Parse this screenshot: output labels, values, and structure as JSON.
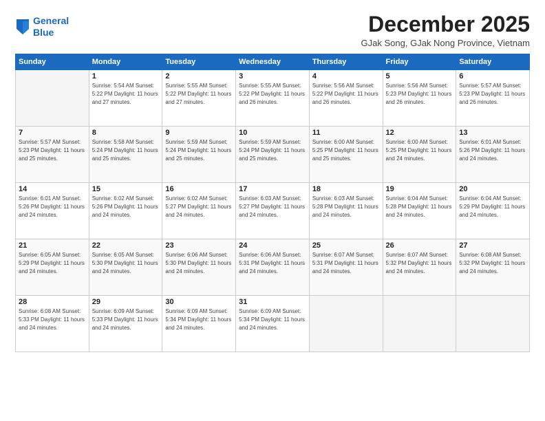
{
  "logo": {
    "line1": "General",
    "line2": "Blue"
  },
  "title": "December 2025",
  "location": "GJak Song, GJak Nong Province, Vietnam",
  "days_header": [
    "Sunday",
    "Monday",
    "Tuesday",
    "Wednesday",
    "Thursday",
    "Friday",
    "Saturday"
  ],
  "weeks": [
    [
      {
        "day": "",
        "info": ""
      },
      {
        "day": "1",
        "info": "Sunrise: 5:54 AM\nSunset: 5:22 PM\nDaylight: 11 hours\nand 27 minutes."
      },
      {
        "day": "2",
        "info": "Sunrise: 5:55 AM\nSunset: 5:22 PM\nDaylight: 11 hours\nand 27 minutes."
      },
      {
        "day": "3",
        "info": "Sunrise: 5:55 AM\nSunset: 5:22 PM\nDaylight: 11 hours\nand 26 minutes."
      },
      {
        "day": "4",
        "info": "Sunrise: 5:56 AM\nSunset: 5:22 PM\nDaylight: 11 hours\nand 26 minutes."
      },
      {
        "day": "5",
        "info": "Sunrise: 5:56 AM\nSunset: 5:23 PM\nDaylight: 11 hours\nand 26 minutes."
      },
      {
        "day": "6",
        "info": "Sunrise: 5:57 AM\nSunset: 5:23 PM\nDaylight: 11 hours\nand 26 minutes."
      }
    ],
    [
      {
        "day": "7",
        "info": "Sunrise: 5:57 AM\nSunset: 5:23 PM\nDaylight: 11 hours\nand 25 minutes."
      },
      {
        "day": "8",
        "info": "Sunrise: 5:58 AM\nSunset: 5:24 PM\nDaylight: 11 hours\nand 25 minutes."
      },
      {
        "day": "9",
        "info": "Sunrise: 5:59 AM\nSunset: 5:24 PM\nDaylight: 11 hours\nand 25 minutes."
      },
      {
        "day": "10",
        "info": "Sunrise: 5:59 AM\nSunset: 5:24 PM\nDaylight: 11 hours\nand 25 minutes."
      },
      {
        "day": "11",
        "info": "Sunrise: 6:00 AM\nSunset: 5:25 PM\nDaylight: 11 hours\nand 25 minutes."
      },
      {
        "day": "12",
        "info": "Sunrise: 6:00 AM\nSunset: 5:25 PM\nDaylight: 11 hours\nand 24 minutes."
      },
      {
        "day": "13",
        "info": "Sunrise: 6:01 AM\nSunset: 5:26 PM\nDaylight: 11 hours\nand 24 minutes."
      }
    ],
    [
      {
        "day": "14",
        "info": "Sunrise: 6:01 AM\nSunset: 5:26 PM\nDaylight: 11 hours\nand 24 minutes."
      },
      {
        "day": "15",
        "info": "Sunrise: 6:02 AM\nSunset: 5:26 PM\nDaylight: 11 hours\nand 24 minutes."
      },
      {
        "day": "16",
        "info": "Sunrise: 6:02 AM\nSunset: 5:27 PM\nDaylight: 11 hours\nand 24 minutes."
      },
      {
        "day": "17",
        "info": "Sunrise: 6:03 AM\nSunset: 5:27 PM\nDaylight: 11 hours\nand 24 minutes."
      },
      {
        "day": "18",
        "info": "Sunrise: 6:03 AM\nSunset: 5:28 PM\nDaylight: 11 hours\nand 24 minutes."
      },
      {
        "day": "19",
        "info": "Sunrise: 6:04 AM\nSunset: 5:28 PM\nDaylight: 11 hours\nand 24 minutes."
      },
      {
        "day": "20",
        "info": "Sunrise: 6:04 AM\nSunset: 5:29 PM\nDaylight: 11 hours\nand 24 minutes."
      }
    ],
    [
      {
        "day": "21",
        "info": "Sunrise: 6:05 AM\nSunset: 5:29 PM\nDaylight: 11 hours\nand 24 minutes."
      },
      {
        "day": "22",
        "info": "Sunrise: 6:05 AM\nSunset: 5:30 PM\nDaylight: 11 hours\nand 24 minutes."
      },
      {
        "day": "23",
        "info": "Sunrise: 6:06 AM\nSunset: 5:30 PM\nDaylight: 11 hours\nand 24 minutes."
      },
      {
        "day": "24",
        "info": "Sunrise: 6:06 AM\nSunset: 5:31 PM\nDaylight: 11 hours\nand 24 minutes."
      },
      {
        "day": "25",
        "info": "Sunrise: 6:07 AM\nSunset: 5:31 PM\nDaylight: 11 hours\nand 24 minutes."
      },
      {
        "day": "26",
        "info": "Sunrise: 6:07 AM\nSunset: 5:32 PM\nDaylight: 11 hours\nand 24 minutes."
      },
      {
        "day": "27",
        "info": "Sunrise: 6:08 AM\nSunset: 5:32 PM\nDaylight: 11 hours\nand 24 minutes."
      }
    ],
    [
      {
        "day": "28",
        "info": "Sunrise: 6:08 AM\nSunset: 5:33 PM\nDaylight: 11 hours\nand 24 minutes."
      },
      {
        "day": "29",
        "info": "Sunrise: 6:09 AM\nSunset: 5:33 PM\nDaylight: 11 hours\nand 24 minutes."
      },
      {
        "day": "30",
        "info": "Sunrise: 6:09 AM\nSunset: 5:34 PM\nDaylight: 11 hours\nand 24 minutes."
      },
      {
        "day": "31",
        "info": "Sunrise: 6:09 AM\nSunset: 5:34 PM\nDaylight: 11 hours\nand 24 minutes."
      },
      {
        "day": "",
        "info": ""
      },
      {
        "day": "",
        "info": ""
      },
      {
        "day": "",
        "info": ""
      }
    ]
  ]
}
